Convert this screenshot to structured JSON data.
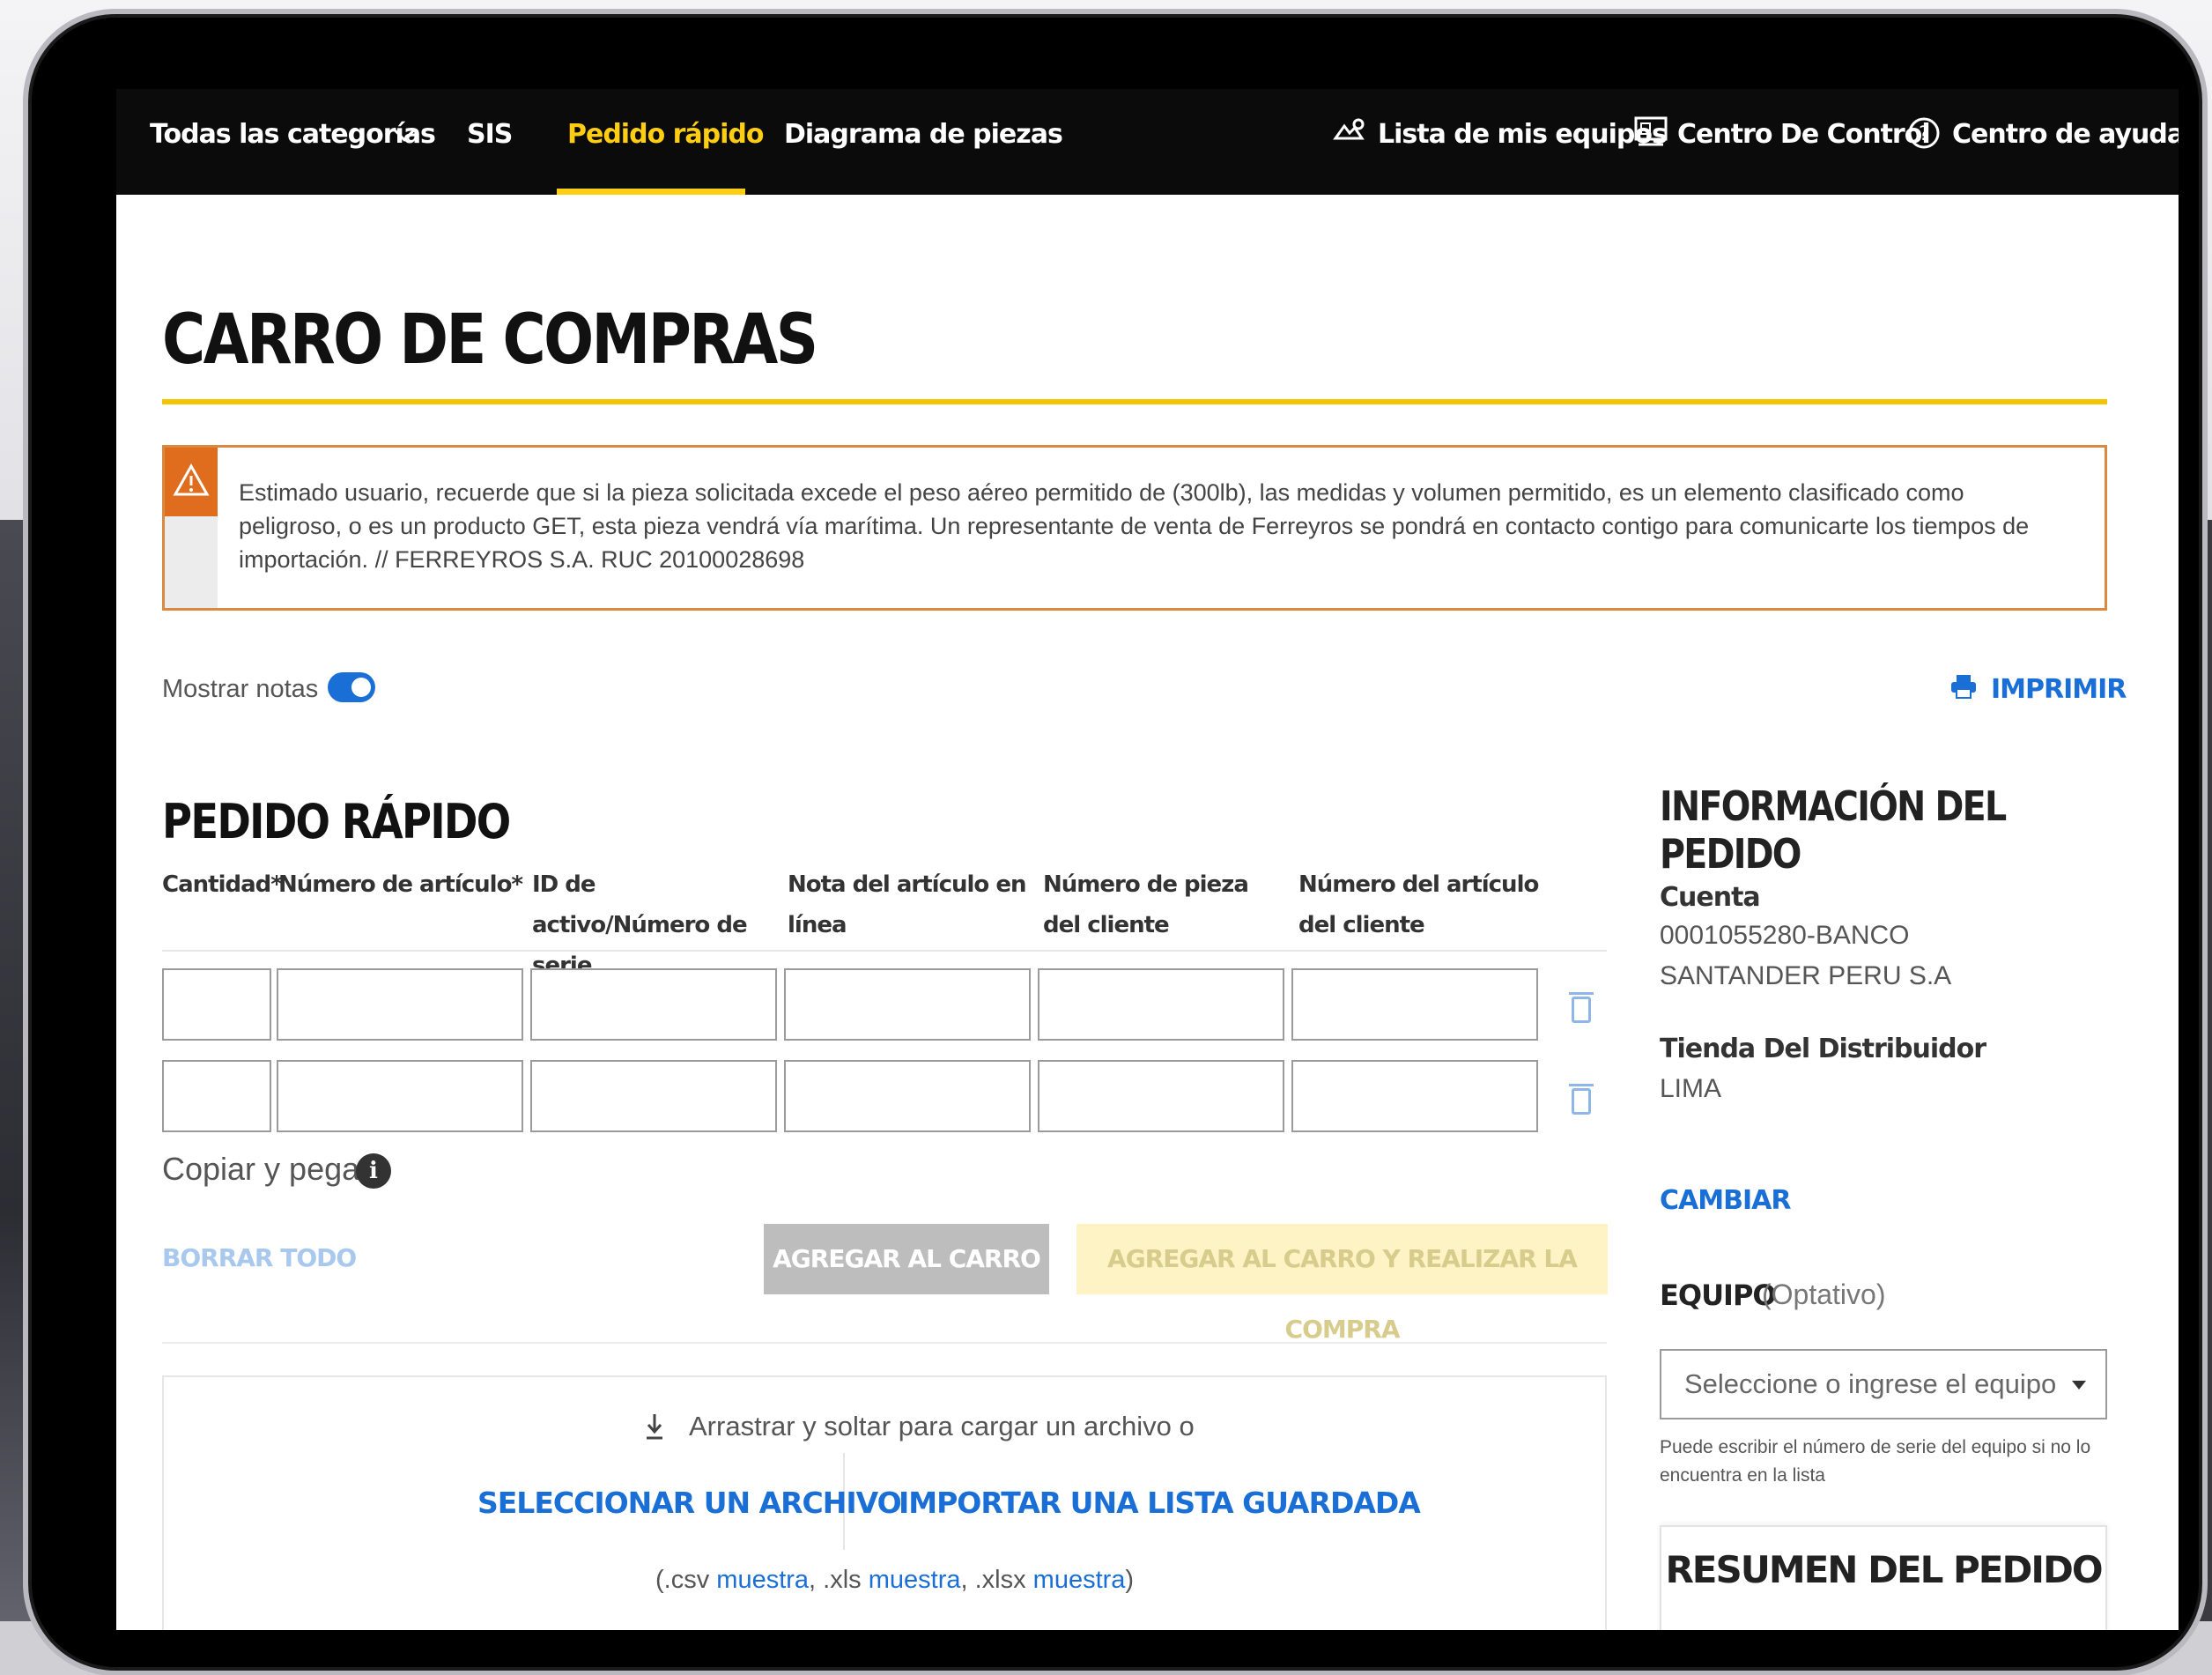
{
  "nav": {
    "all_categories": "Todas las categorías",
    "sis": "SIS",
    "quick_order": "Pedido rápido",
    "parts_diagram": "Diagrama de piezas",
    "my_equipment": "Lista de mis equipos",
    "control_center": "Centro De Control",
    "help_center": "Centro de ayuda",
    "active_color": "#ffcd11"
  },
  "page": {
    "title": "CARRO DE COMPRAS"
  },
  "alert": {
    "icon": "warning-icon",
    "text": "Estimado usuario, recuerde que si la pieza solicitada excede el peso aéreo permitido de (300lb), las medidas y volumen permitido, es un elemento clasificado como peligroso, o es un producto GET, esta pieza vendrá vía marítima. Un representante de venta de Ferreyros se pondrá en contacto contigo para comunicarte los tiempos de importación. // FERREYROS S.A. RUC 20100028698"
  },
  "toolbar": {
    "show_notes": "Mostrar notas",
    "show_notes_on": true,
    "print": "IMPRIMIR"
  },
  "quick_order": {
    "title": "PEDIDO RÁPIDO",
    "columns": [
      "Cantidad*",
      "Número de artículo*",
      "ID de activo/Número de serie",
      "Nota del artículo en línea",
      "Número de pieza del cliente",
      "Número del artículo del cliente"
    ],
    "rows": [
      [
        "",
        "",
        "",
        "",
        "",
        ""
      ],
      [
        "",
        "",
        "",
        "",
        "",
        ""
      ]
    ],
    "copy_paste": "Copiar y pegar",
    "clear_all": "BORRAR TODO",
    "add_to_cart": "AGREGAR AL CARRO",
    "add_and_checkout": "AGREGAR AL CARRO Y REALIZAR LA COMPRA"
  },
  "upload": {
    "drag_text": "Arrastrar y soltar para cargar un archivo o",
    "select_file": "SELECCIONAR UN ARCHIVO",
    "import_list": "IMPORTAR UNA LISTA GUARDADA",
    "samples_open": "(.csv ",
    "sample_link": "muestra",
    "sep_xls": ", .xls ",
    "sep_xlsx": ", .xlsx ",
    "samples_close": ")"
  },
  "order_info": {
    "title": "INFORMACIÓN DEL PEDIDO",
    "account_label": "Cuenta",
    "account_value": "0001055280-BANCO SANTANDER PERU S.A",
    "store_label": "Tienda Del Distribuidor",
    "store_value": "LIMA",
    "change": "CAMBIAR",
    "equipment_label": "EQUIPO",
    "equipment_optional": "(Optativo)",
    "equipment_placeholder": "Seleccione o ingrese el equipo",
    "equipment_help": "Puede escribir el número de serie del equipo si no lo encuentra en la lista",
    "summary_title": "RESUMEN DEL PEDIDO"
  },
  "colors": {
    "accent_yellow": "#ffcd11",
    "link_blue": "#1a6fd6",
    "warning_orange": "#e06c1e"
  }
}
